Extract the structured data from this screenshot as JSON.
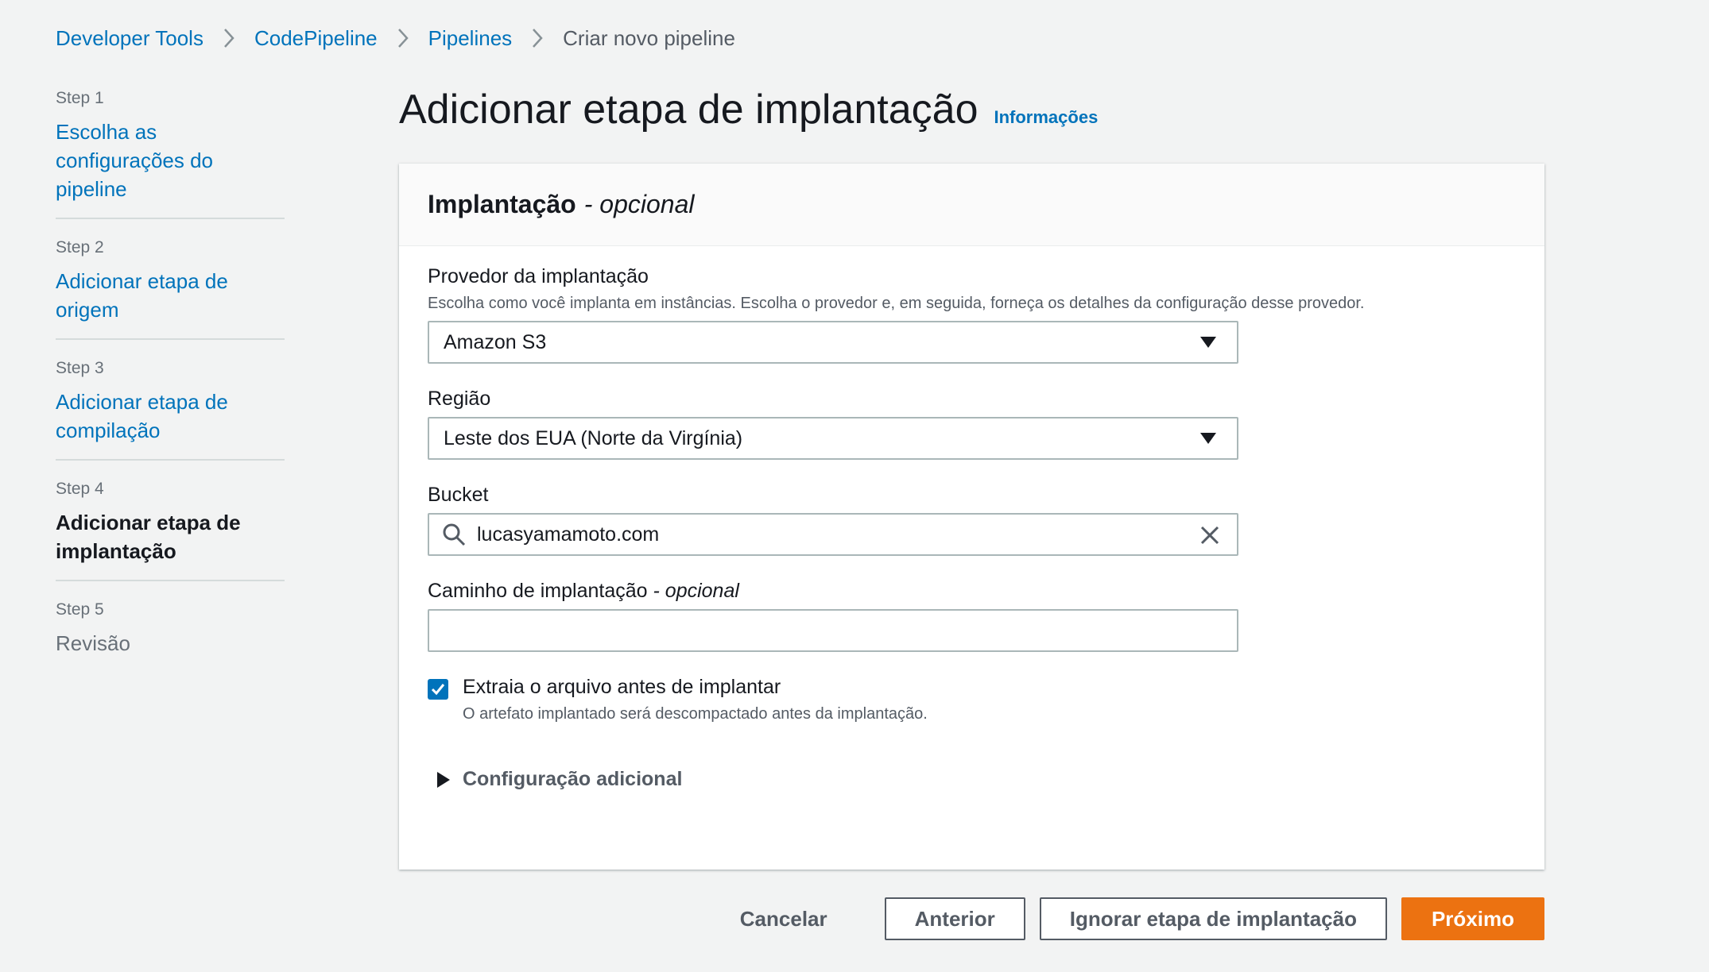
{
  "breadcrumb": {
    "items": [
      "Developer Tools",
      "CodePipeline",
      "Pipelines"
    ],
    "current": "Criar novo pipeline"
  },
  "steps": [
    {
      "num": "Step 1",
      "title": "Escolha as configurações do pipeline"
    },
    {
      "num": "Step 2",
      "title": "Adicionar etapa de origem"
    },
    {
      "num": "Step 3",
      "title": "Adicionar etapa de compilação"
    },
    {
      "num": "Step 4",
      "title": "Adicionar etapa de implantação"
    },
    {
      "num": "Step 5",
      "title": "Revisão"
    }
  ],
  "page": {
    "title": "Adicionar etapa de implantação",
    "info_link": "Informações"
  },
  "panel": {
    "title": "Implantação",
    "title_optional": "- opcional",
    "provider": {
      "label": "Provedor da implantação",
      "description": "Escolha como você implanta em instâncias. Escolha o provedor e, em seguida, forneça os detalhes da configuração desse provedor.",
      "value": "Amazon S3"
    },
    "region": {
      "label": "Região",
      "value": "Leste dos EUA (Norte da Virgínia)"
    },
    "bucket": {
      "label": "Bucket",
      "value": "lucasyamamoto.com"
    },
    "deploy_path": {
      "label": "Caminho de implantação",
      "label_optional": "- opcional",
      "value": ""
    },
    "extract": {
      "checked": true,
      "label": "Extraia o arquivo antes de implantar",
      "description": "O artefato implantado será descompactado antes da implantação."
    },
    "additional": "Configuração adicional"
  },
  "actions": {
    "cancel": "Cancelar",
    "previous": "Anterior",
    "skip": "Ignorar etapa de implantação",
    "next": "Próximo"
  },
  "colors": {
    "link": "#0073bb",
    "primary": "#ec7211",
    "background": "#f2f3f3"
  }
}
